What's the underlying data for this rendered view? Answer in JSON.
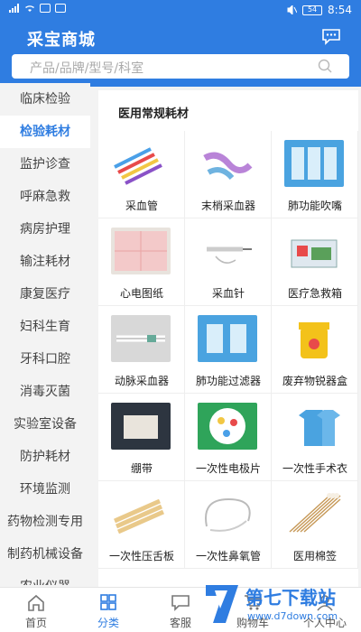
{
  "status_bar": {
    "time": "8:54",
    "battery": "54"
  },
  "header": {
    "brand": "采宝商城"
  },
  "search": {
    "placeholder": "产品/品牌/型号/科室"
  },
  "sidebar": {
    "items": [
      {
        "label": "临床检验"
      },
      {
        "label": "检验耗材"
      },
      {
        "label": "监护诊查"
      },
      {
        "label": "呼麻急救"
      },
      {
        "label": "病房护理"
      },
      {
        "label": "输注耗材"
      },
      {
        "label": "康复医疗"
      },
      {
        "label": "妇科生育"
      },
      {
        "label": "牙科口腔"
      },
      {
        "label": "消毒灭菌"
      },
      {
        "label": "实验室设备"
      },
      {
        "label": "防护耗材"
      },
      {
        "label": "环境监测"
      },
      {
        "label": "药物检测专用"
      },
      {
        "label": "制药机械设备"
      },
      {
        "label": "农业仪器"
      }
    ],
    "active_index": 1
  },
  "content": {
    "section_title": "医用常规耗材",
    "products": [
      {
        "label": "采血管"
      },
      {
        "label": "末梢采血器"
      },
      {
        "label": "肺功能吹嘴"
      },
      {
        "label": "心电图纸"
      },
      {
        "label": "采血针"
      },
      {
        "label": "医疗急救箱"
      },
      {
        "label": "动脉采血器"
      },
      {
        "label": "肺功能过滤器"
      },
      {
        "label": "废弃物锐器盒"
      },
      {
        "label": "绷带"
      },
      {
        "label": "一次性电极片"
      },
      {
        "label": "一次性手术衣"
      },
      {
        "label": "一次性压舌板"
      },
      {
        "label": "一次性鼻氧管"
      },
      {
        "label": "医用棉签"
      }
    ]
  },
  "tabbar": {
    "tabs": [
      {
        "label": "首页"
      },
      {
        "label": "分类"
      },
      {
        "label": "客服"
      },
      {
        "label": "购物车"
      },
      {
        "label": "个人中心"
      }
    ],
    "active_index": 1
  },
  "watermark": {
    "text": "第七下载站",
    "url": "www.d7down.com"
  },
  "colors": {
    "accent": "#2f7de1",
    "background": "#f3f3f3"
  }
}
